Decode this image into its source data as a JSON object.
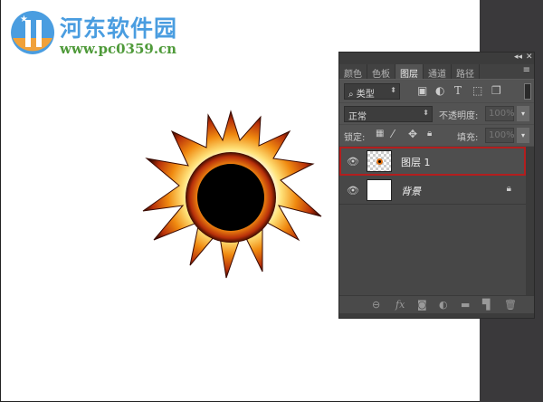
{
  "watermark": {
    "title": "河东软件园",
    "url": "www.pc0359.cn"
  },
  "panel": {
    "collapse_label": "◂◂",
    "close_label": "✕",
    "tabs": [
      {
        "label": "颜色"
      },
      {
        "label": "色板"
      },
      {
        "label": "图层",
        "active": true
      },
      {
        "label": "通道"
      },
      {
        "label": "路径"
      }
    ],
    "menu_icon": "≡",
    "filter": {
      "kind_label": "类型"
    },
    "blend_mode": "正常",
    "opacity_label": "不透明度:",
    "opacity_value": "100%",
    "lock_label": "锁定:",
    "fill_label": "填充:",
    "fill_value": "100%",
    "layers": [
      {
        "name": "图层 1",
        "selected": true
      },
      {
        "name": "背景",
        "locked": true
      }
    ]
  },
  "colors": {
    "highlight": "#b31e1e",
    "panel": "#535353"
  }
}
